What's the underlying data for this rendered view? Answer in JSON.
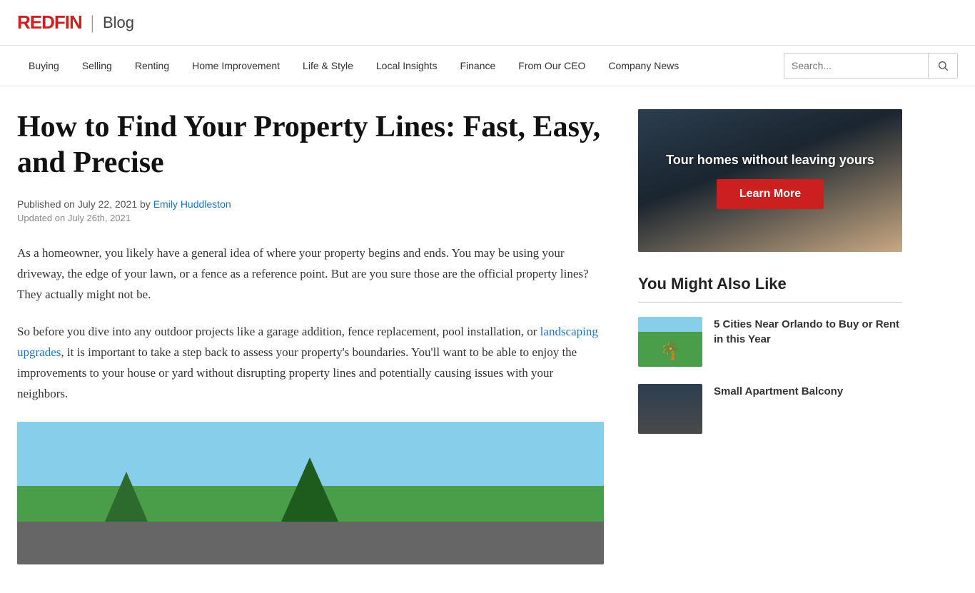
{
  "brand": {
    "name": "REDFIN",
    "divider": "|",
    "blog": "Blog"
  },
  "nav": {
    "items": [
      {
        "label": "Buying",
        "href": "#"
      },
      {
        "label": "Selling",
        "href": "#"
      },
      {
        "label": "Renting",
        "href": "#"
      },
      {
        "label": "Home Improvement",
        "href": "#"
      },
      {
        "label": "Life & Style",
        "href": "#"
      },
      {
        "label": "Local Insights",
        "href": "#"
      },
      {
        "label": "Finance",
        "href": "#"
      },
      {
        "label": "From Our CEO",
        "href": "#"
      },
      {
        "label": "Company News",
        "href": "#"
      }
    ],
    "search_placeholder": "Search..."
  },
  "article": {
    "title": "How to Find Your Property Lines: Fast, Easy, and Precise",
    "published": "Published on July 22, 2021 by",
    "author": "Emily Huddleston",
    "updated": "Updated on July 26th, 2021",
    "body_p1": "As a homeowner, you likely have a general idea of where your property begins and ends. You may be using your driveway, the edge of your lawn, or a fence as a reference point. But are you sure those are the official property lines? They actually might not be.",
    "body_p2_before_link": "So before you dive into any outdoor projects like a garage addition, fence replacement, pool installation, or ",
    "body_p2_link": "landscaping upgrades",
    "body_p2_after_link": ", it is important to take a step back to assess your property's boundaries. You'll want to be able to enjoy the improvements to your house or yard without disrupting property lines and potentially causing issues with your neighbors."
  },
  "ad_banner": {
    "text": "Tour homes without leaving yours",
    "button_label": "Learn More"
  },
  "sidebar": {
    "section_title": "You Might Also Like",
    "related_items": [
      {
        "title": "5 Cities Near Orlando to Buy or Rent in this Year",
        "thumb_type": "orlando"
      },
      {
        "title": "Small Apartment Balcony",
        "thumb_type": "balcony"
      }
    ]
  }
}
